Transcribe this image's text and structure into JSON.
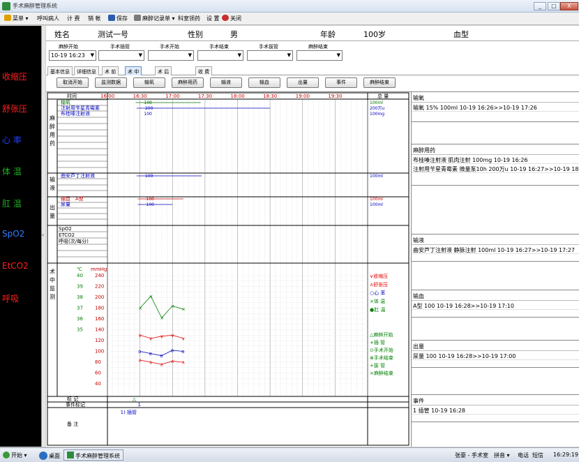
{
  "window": {
    "title": "手术麻醉管理系统",
    "controls": [
      "_",
      "□",
      "X"
    ]
  },
  "menu": [
    {
      "label": "菜单",
      "icon": "menu-icon",
      "color": "#e0a000"
    },
    {
      "label": "呼叫病人",
      "icon": "",
      "color": ""
    },
    {
      "label": "计 费",
      "icon": "",
      "color": ""
    },
    {
      "label": "销 帐",
      "icon": "",
      "color": ""
    },
    {
      "label": "保存",
      "icon": "save-icon",
      "color": "#2a5db0"
    },
    {
      "label": "麻醉记录单",
      "icon": "record-icon",
      "color": "#7a7a7a"
    },
    {
      "label": "科室领药",
      "icon": "",
      "color": ""
    },
    {
      "label": "设 置",
      "icon": "",
      "color": ""
    },
    {
      "label": "关闭",
      "icon": "close-icon",
      "color": "#c83030"
    }
  ],
  "vitals_legend": [
    {
      "label": "收缩压",
      "color": "#ff2020"
    },
    {
      "label": "舒张压",
      "color": "#ff2020"
    },
    {
      "label": "心  率",
      "color": "#2040ff"
    },
    {
      "label": "体  温",
      "color": "#20b020"
    },
    {
      "label": "肛  温",
      "color": "#20b020"
    },
    {
      "label": "SpO2",
      "color": "#3080ff"
    },
    {
      "label": "EtCO2",
      "color": "#ff2020"
    },
    {
      "label": "呼吸",
      "color": "#ff2020"
    }
  ],
  "patient": {
    "name_label": "姓名",
    "name": "测试一号",
    "sex_label": "性别",
    "sex": "男",
    "age_label": "年龄",
    "age": "100岁",
    "blood_label": "血型",
    "blood": ""
  },
  "times": [
    {
      "label": "麻醉开始",
      "value": "10-19 16:23"
    },
    {
      "label": "手术插管",
      "value": ""
    },
    {
      "label": "手术开始",
      "value": ""
    },
    {
      "label": "手术结束",
      "value": ""
    },
    {
      "label": "手术拔管",
      "value": ""
    },
    {
      "label": "麻醉结束",
      "value": ""
    }
  ],
  "tabs": [
    {
      "label": "基本信息",
      "active": false
    },
    {
      "label": "详细信息",
      "active": false
    },
    {
      "label": "术 前",
      "active": false
    },
    {
      "label": "术 中",
      "active": true
    },
    {
      "label": "术 后",
      "active": false
    },
    {
      "label": "收 费",
      "active": false
    }
  ],
  "buttons": [
    "取消开始",
    "监测数据",
    "输氧",
    "麻醉用药",
    "输液",
    "输血",
    "出量",
    "事件",
    "麻醉结束"
  ],
  "grid": {
    "time_header": "时间",
    "total_header": "总 量",
    "time_ticks": [
      "16:00",
      "16:30",
      "17:00",
      "17:30",
      "18:00",
      "18:30",
      "19:00",
      "19:30"
    ],
    "sections": {
      "drug": "麻醉用药",
      "fluid": "输液",
      "output": "出量",
      "monitor": "术中监测"
    },
    "drug_rows": [
      {
        "name": "输氧",
        "value": "100",
        "total": "100ml",
        "color": "#007000",
        "start": "16:26",
        "end": "17:26"
      },
      {
        "name": "注射用苄星青霉素",
        "value": "200",
        "total": "200万u",
        "color": "#0000c0",
        "start": "16:27",
        "end": "18:30"
      },
      {
        "name": "布桂嗪注射液",
        "value": "100",
        "total": "100mg",
        "color": "#0000c0",
        "start": "16:26",
        "end": ""
      }
    ],
    "fluid_rows": [
      {
        "name": "曲安芦丁注射液",
        "value": "100",
        "total": "100ml",
        "color": "#0000c0",
        "start": "16:27",
        "end": "17:27"
      }
    ],
    "blood_rows": [
      {
        "name": "输血",
        "name2": "A型",
        "value": "100",
        "total": "100ml",
        "color": "#c00000",
        "start": "16:28",
        "end": "17:10"
      }
    ],
    "output_rows": [
      {
        "name": "尿量",
        "value": "100",
        "total": "100ml",
        "color": "#0000c0",
        "start": "16:28",
        "end": "17:00"
      }
    ],
    "monitor_rows": [
      "SpO2",
      "ETCO2",
      "呼吸(次/每分)"
    ],
    "temp_unit": "℃",
    "bp_unit": "mmHg",
    "temp_ticks": [
      "40",
      "39",
      "38",
      "37",
      "36",
      "35"
    ],
    "bp_ticks": [
      "240",
      "220",
      "200",
      "180",
      "160",
      "140",
      "120",
      "100",
      "80",
      "60",
      "40"
    ],
    "legend_right": [
      {
        "label": "∨收缩压",
        "color": "#e00000"
      },
      {
        "label": "∧舒张压",
        "color": "#e00000"
      },
      {
        "label": "○心  率",
        "color": "#0000c0"
      },
      {
        "label": "×体  温",
        "color": "#008000"
      },
      {
        "label": "●肛  温",
        "color": "#008000"
      }
    ],
    "legend_events": [
      "△麻醉开始",
      "+插    管",
      "⊙手术开始",
      "⊗手术结束",
      "+拔    管",
      "×麻醉结束"
    ],
    "mark_label": "标    记",
    "mark_symbol": "△",
    "event_mark_label": "事件标记",
    "event_mark_value": "1",
    "note_label": "备    注",
    "note_value": "1) 插管"
  },
  "chart_data": {
    "type": "line",
    "x_times": [
      "16:30",
      "16:40",
      "16:50",
      "17:00",
      "17:10"
    ],
    "series": [
      {
        "name": "收缩压",
        "values": [
          130,
          124,
          128,
          130,
          124
        ]
      },
      {
        "name": "舒张压",
        "values": [
          84,
          80,
          76,
          82,
          80
        ]
      },
      {
        "name": "心率",
        "values": [
          100,
          96,
          92,
          102,
          100
        ]
      },
      {
        "name": "体温",
        "values": [
          37.0,
          38.1,
          36.1,
          37.2,
          36.9
        ]
      }
    ],
    "ylim_bp": [
      40,
      240
    ],
    "ylim_temp": [
      35,
      40
    ]
  },
  "right_panel": [
    {
      "title": "输氧",
      "lines": [
        "输氧 15% 100ml 10-19 16:26>>10-19 17:26"
      ]
    },
    {
      "title": "麻醉用药",
      "lines": [
        "布桂嗪注射液 肌肉注射 100mg 10-19 16:26",
        "注射用苄星青霉素 微量泵10h 200万u 10-19 16:27>>10-19 18"
      ]
    },
    {
      "title": "输液",
      "lines": [
        "曲安芦丁注射液 静脉注射 100ml 10-19 16:27>>10-19 17:27"
      ]
    },
    {
      "title": "输血",
      "lines": [
        "A型 100 10-19 16:28>>10-19 17:10"
      ]
    },
    {
      "title": "出量",
      "lines": [
        "尿量 100 10-19 16:28>>10-19 17:00"
      ]
    },
    {
      "title": "事件",
      "lines": [
        "1 插管 10-19 16:28"
      ]
    }
  ],
  "taskbar": {
    "start": "开始",
    "desktop": "桌面",
    "app": "手术麻醉管理系统",
    "user": "张豪 - 手术室",
    "ime": "拼音",
    "phone": "电话",
    "sms": "短信",
    "clock": "16:29:19"
  }
}
